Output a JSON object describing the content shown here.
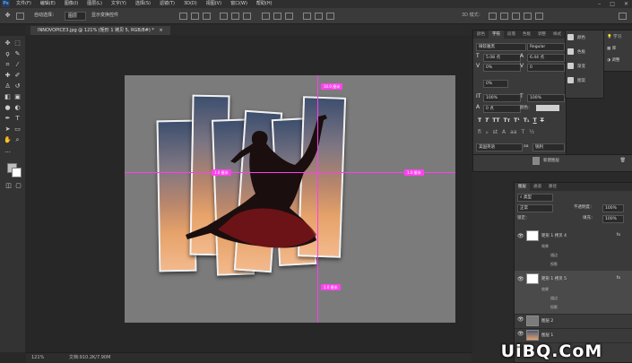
{
  "menubar": {
    "logo": "Ps",
    "items": [
      "文件(F)",
      "编辑(E)",
      "图像(I)",
      "图层(L)",
      "文字(Y)",
      "选择(S)",
      "滤镜(T)",
      "3D(D)",
      "视图(V)",
      "窗口(W)",
      "帮助(H)"
    ],
    "window_controls": [
      "–",
      "□",
      "✕"
    ]
  },
  "options": {
    "auto_select_label": "自动选择：",
    "auto_select_value": "图层",
    "show_transform_label": "显示变换控件",
    "mode_3d_label": "3D 模式："
  },
  "document": {
    "tab_title": "INNOVOPICE3.jpg @ 121% (矩形 1 拷贝 5, RGB/8#) *",
    "close": "×"
  },
  "smart_guides": {
    "top": "10.0 厘米",
    "left": "1.0 厘米",
    "right": "1.0 厘米",
    "bottom": "1.0 厘米"
  },
  "statusbar": {
    "zoom": "121%",
    "doc_info": "文档:910.2K/7.90M"
  },
  "character_panel": {
    "tabs": [
      "颜色",
      "字符",
      "段落",
      "色板",
      "调整",
      "样式"
    ],
    "font_family": "微软雅黑",
    "font_style": "Regular",
    "font_size": "5.08 点",
    "leading": "6.44 点",
    "tracking": "0",
    "kerning": "0%",
    "vertical_scale": "100%",
    "horizontal_scale": "100%",
    "baseline": "0 点",
    "color_label": "颜色：",
    "language": "美国英语",
    "antialias": "锐利",
    "aa_label": "aa"
  },
  "mini_panel": {
    "items": [
      "颜色",
      "色板",
      "渐变",
      "图案"
    ]
  },
  "learn_panel": {
    "items": [
      "学习",
      "库",
      "调整"
    ]
  },
  "history_panel": {
    "item": "新建图层"
  },
  "layers_panel": {
    "tabs": [
      "图层",
      "通道",
      "路径"
    ],
    "filter": "类型",
    "blend_mode": "正常",
    "opacity_label": "不透明度：",
    "opacity_value": "100%",
    "lock_label": "锁定：",
    "fill_label": "填充：",
    "fill_value": "100%",
    "layers": [
      {
        "name": "矩形 1 拷贝 4",
        "fx": "fx",
        "effects_label": "效果",
        "effects": [
          "描边",
          "投影"
        ]
      },
      {
        "name": "矩形 1 拷贝 5",
        "fx": "fx",
        "effects_label": "效果",
        "effects": [
          "描边",
          "投影"
        ]
      },
      {
        "name": "图层 2"
      },
      {
        "name": "图层 1"
      }
    ]
  },
  "watermark": "UiBQ.CoM",
  "colors": {
    "accent_guide": "#ff3df0",
    "photoshop_blue": "#46a6ff"
  },
  "icons": [
    "move-icon",
    "marquee-icon",
    "lasso-icon",
    "quick-select-icon",
    "crop-icon",
    "eyedropper-icon",
    "healing-icon",
    "brush-icon",
    "stamp-icon",
    "history-brush-icon",
    "eraser-icon",
    "gradient-icon",
    "blur-icon",
    "dodge-icon",
    "pen-icon",
    "type-icon",
    "path-select-icon",
    "rectangle-icon",
    "hand-icon",
    "zoom-icon",
    "eye-icon",
    "search-icon"
  ]
}
